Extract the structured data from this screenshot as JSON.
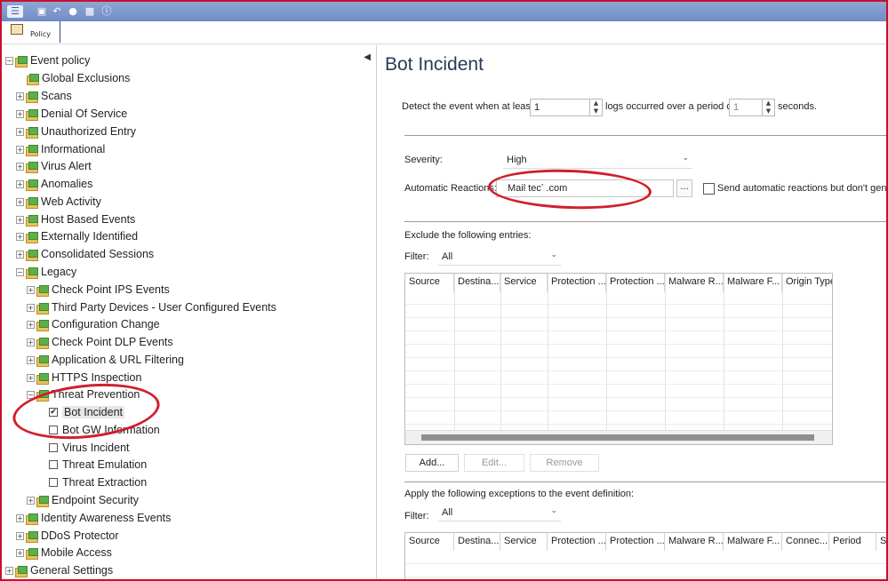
{
  "ribbon": {
    "policy_label": "Policy"
  },
  "tree": {
    "root": "Event policy",
    "global_exclusions": "Global Exclusions",
    "items": [
      "Scans",
      "Denial Of Service",
      "Unauthorized Entry",
      "Informational",
      "Virus Alert",
      "Anomalies",
      "Web Activity",
      "Host Based Events",
      "Externally Identified",
      "Consolidated Sessions"
    ],
    "legacy": "Legacy",
    "legacy_items": [
      "Check Point IPS Events",
      "Third Party Devices - User Configured Events",
      "Configuration Change",
      "Check Point DLP Events",
      "Application & URL Filtering",
      "HTTPS Inspection"
    ],
    "threat_prevention": "Threat Prevention",
    "threat_items": [
      {
        "label": "Bot Incident",
        "checked": true
      },
      {
        "label": "Bot GW Information",
        "checked": false
      },
      {
        "label": "Virus Incident",
        "checked": false
      },
      {
        "label": "Threat Emulation",
        "checked": false
      },
      {
        "label": "Threat Extraction",
        "checked": false
      }
    ],
    "endpoint_security": "Endpoint Security",
    "after_items": [
      "Identity Awareness Events",
      "DDoS Protector",
      "Mobile Access"
    ],
    "general_settings": "General Settings"
  },
  "detail": {
    "title": "Bot Incident",
    "detect_prefix": "Detect the event when at least",
    "logs_value": "1",
    "detect_middle": "logs occurred over a period of",
    "period_value": "1",
    "detect_suffix": "seconds.",
    "severity_label": "Severity:",
    "severity_value": "High",
    "reactions_label": "Automatic Reactions:",
    "reactions_value": "Mail tecʼ  .com",
    "browse_label": "...",
    "send_auto_label": "Send automatic reactions but don't gene",
    "exclude_label": "Exclude the following entries:",
    "filter_label": "Filter:",
    "filter_value": "All",
    "exclude_columns": [
      "Source",
      "Destina...",
      "Service",
      "Protection ...",
      "Protection ...",
      "Malware R...",
      "Malware F...",
      "Origin Type"
    ],
    "add_label": "Add...",
    "edit_label": "Edit...",
    "remove_label": "Remove",
    "exceptions_label": "Apply the following exceptions to the event definition:",
    "filter2_label": "Filter:",
    "filter2_value": "All",
    "exception_columns": [
      "Source",
      "Destina...",
      "Service",
      "Protection ...",
      "Protection ...",
      "Malware R...",
      "Malware F...",
      "Connec...",
      "Period",
      "So"
    ]
  },
  "colors": {
    "titlebar": "#7a95ca",
    "annotation": "#d01f2d",
    "title_text": "#2a3a5a"
  }
}
